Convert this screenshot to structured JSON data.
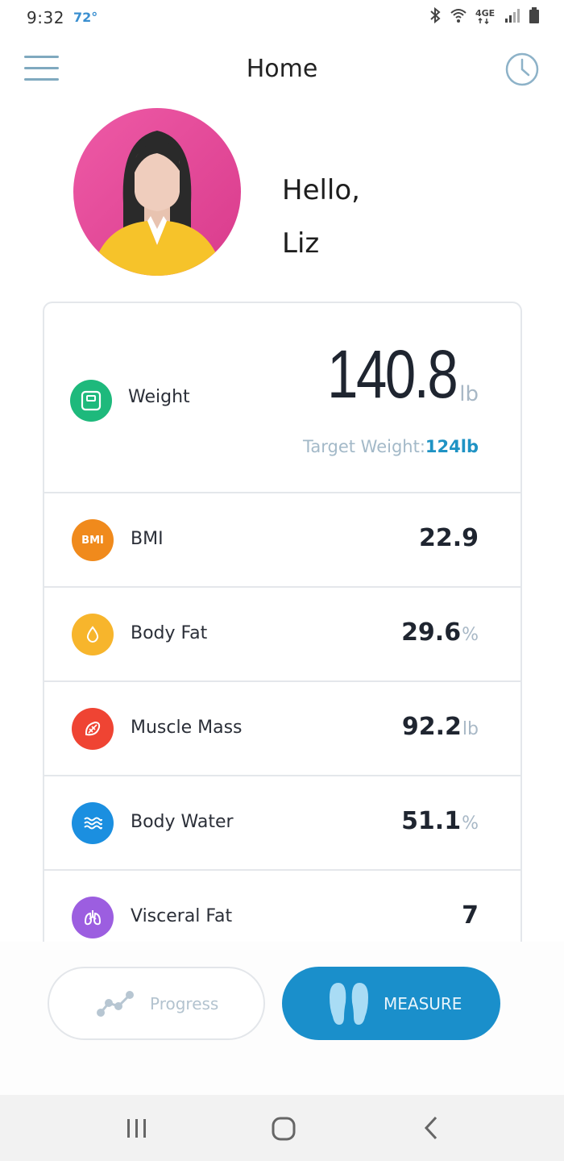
{
  "status_bar": {
    "time": "9:32",
    "temperature": "72°",
    "icons": [
      "bluetooth-icon",
      "wifi-icon",
      "4g-icon",
      "signal-icon",
      "battery-icon"
    ]
  },
  "header": {
    "title": "Home",
    "menu_icon": "hamburger-menu-icon",
    "history_icon": "clock-icon"
  },
  "greeting": {
    "line1": "Hello,",
    "line2": "Liz"
  },
  "weight": {
    "label": "Weight",
    "value": "140.8",
    "unit": "lb",
    "target_label": "Target Weight:",
    "target_value": "124lb",
    "icon": "scale-icon",
    "color": "#1eb97c"
  },
  "metrics": [
    {
      "label": "BMI",
      "value": "22.9",
      "unit": "",
      "icon": "bmi-icon",
      "color": "#f08a1c"
    },
    {
      "label": "Body Fat",
      "value": "29.6",
      "unit": "%",
      "icon": "drop-icon",
      "color": "#f7b52c"
    },
    {
      "label": "Muscle Mass",
      "value": "92.2",
      "unit": "lb",
      "icon": "muscle-icon",
      "color": "#ef4433"
    },
    {
      "label": "Body Water",
      "value": "51.1",
      "unit": "%",
      "icon": "water-waves-icon",
      "color": "#1b8fe0"
    },
    {
      "label": "Visceral Fat",
      "value": "7",
      "unit": "",
      "icon": "lungs-icon",
      "color": "#9c5ee0"
    }
  ],
  "bmi_badge": "BMI",
  "actions": {
    "progress_label": "Progress",
    "measure_label": "MEASURE",
    "accent": "#1a8fcb"
  },
  "nav": {
    "recent_icon": "recent-apps-icon",
    "home_icon": "home-icon",
    "back_icon": "back-icon"
  }
}
